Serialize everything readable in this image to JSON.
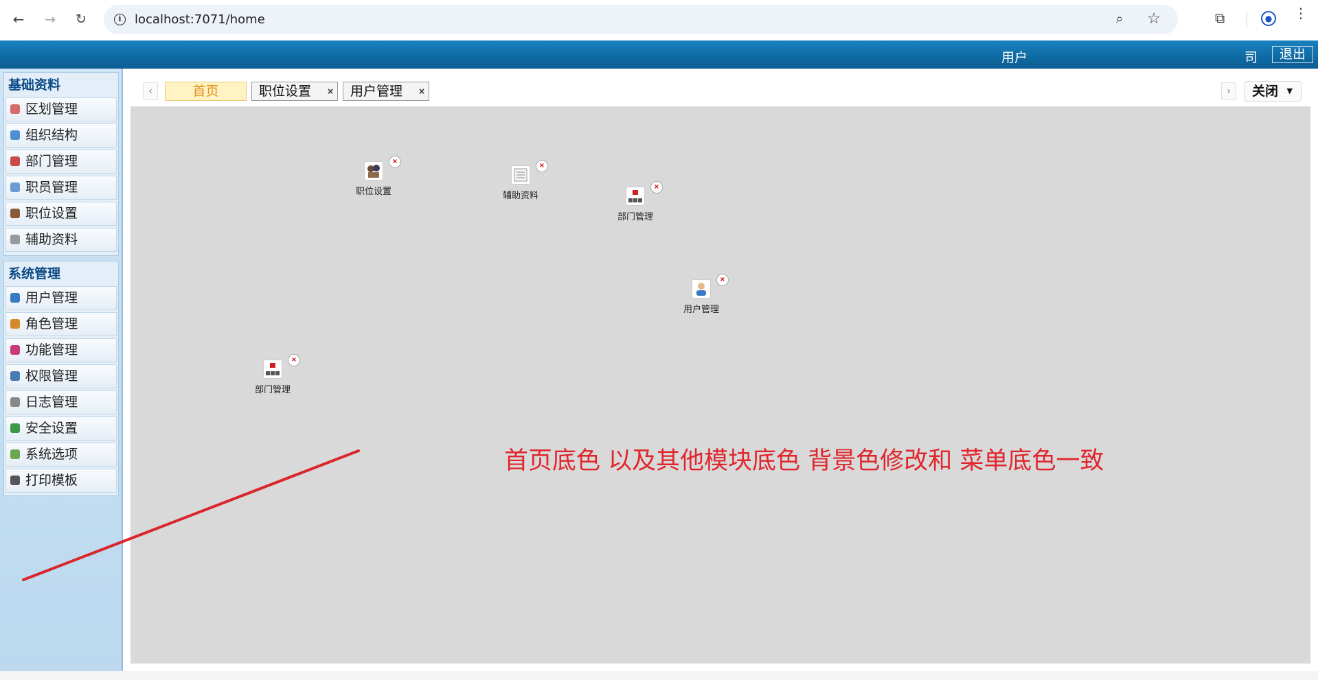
{
  "browser": {
    "url": "localhost:7071/home",
    "back_icon": "←",
    "forward_icon": "→",
    "reload_icon": "↻",
    "info_icon": "i",
    "zoom_icon": "⌕",
    "star_icon": "☆",
    "extensions_icon": "⧉",
    "profile_icon": "●",
    "menu_icon": "⋮"
  },
  "header": {
    "user_label": "用户",
    "company_label": "司",
    "logout_label": "退出"
  },
  "sidebar": {
    "groups": [
      {
        "title": "基础资料",
        "items": [
          {
            "label": "区划管理",
            "icon": "region-icon",
            "color": "#d46a6a"
          },
          {
            "label": "组织结构",
            "icon": "org-icon",
            "color": "#4f8fd1"
          },
          {
            "label": "部门管理",
            "icon": "department-icon",
            "color": "#c84a4a"
          },
          {
            "label": "职员管理",
            "icon": "staff-icon",
            "color": "#6a9bd1"
          },
          {
            "label": "职位设置",
            "icon": "position-icon",
            "color": "#8a5a3a"
          },
          {
            "label": "辅助资料",
            "icon": "auxiliary-icon",
            "color": "#999999"
          }
        ]
      },
      {
        "title": "系统管理",
        "items": [
          {
            "label": "用户管理",
            "icon": "user-icon",
            "color": "#3a7ac4"
          },
          {
            "label": "角色管理",
            "icon": "role-icon",
            "color": "#d48a2a"
          },
          {
            "label": "功能管理",
            "icon": "function-icon",
            "color": "#c83a7a"
          },
          {
            "label": "权限管理",
            "icon": "permission-icon",
            "color": "#4a7ab4"
          },
          {
            "label": "日志管理",
            "icon": "log-icon",
            "color": "#888888"
          },
          {
            "label": "安全设置",
            "icon": "security-icon",
            "color": "#3a9a4a"
          },
          {
            "label": "系统选项",
            "icon": "options-icon",
            "color": "#6aa84f"
          },
          {
            "label": "打印模板",
            "icon": "print-icon",
            "color": "#555555"
          }
        ]
      }
    ]
  },
  "tabs": {
    "home": "首页",
    "items": [
      {
        "label": "职位设置",
        "close": "×"
      },
      {
        "label": "用户管理",
        "close": "×"
      }
    ],
    "scroll_left": "‹",
    "scroll_right": "›",
    "close_menu": "关闭",
    "close_caret": "▼"
  },
  "desktop": {
    "shortcuts": [
      {
        "label": "职位设置",
        "icon": "position-icon"
      },
      {
        "label": "辅助资料",
        "icon": "auxiliary-icon"
      },
      {
        "label": "部门管理",
        "icon": "department-icon"
      },
      {
        "label": "用户管理",
        "icon": "user-icon"
      },
      {
        "label": "部门管理",
        "icon": "department-icon"
      }
    ],
    "remove_label": "×",
    "annotation": "首页底色  以及其他模块底色 背景色修改和  菜单底色一致",
    "background_color": "#d9d9d9"
  },
  "colors": {
    "header_blue": "#0f6aa3",
    "annotation_red": "#e0262c",
    "home_tab_text": "#e08a16"
  }
}
